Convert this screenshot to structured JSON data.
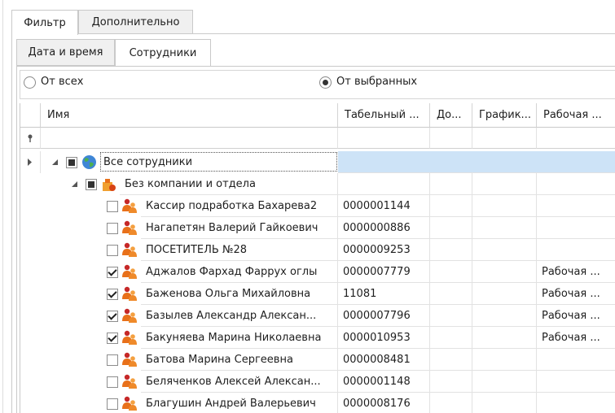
{
  "tabs": {
    "filter": "Фильтр",
    "additional": "Дополнительно"
  },
  "subtabs": {
    "datetime": "Дата и время",
    "employees": "Сотрудники"
  },
  "radios": {
    "from_all": "От всех",
    "from_selected": "От выбранных",
    "selected": "from_selected"
  },
  "grid": {
    "columns": [
      "Имя",
      "Табельный ...",
      "До...",
      "График...",
      "Рабочая ..."
    ],
    "root": "Все сотрудники",
    "group": "Без компании и отдела",
    "rows": [
      {
        "name": "Кассир подработка Бахарева2",
        "tab": "0000001144",
        "work": "",
        "checked": false
      },
      {
        "name": "Нагапетян Валерий Гайкоевич",
        "tab": "0000000886",
        "work": "",
        "checked": false
      },
      {
        "name": "ПОСЕТИТЕЛЬ №28",
        "tab": "0000009253",
        "work": "",
        "checked": false
      },
      {
        "name": "Аджалов Фархад Фаррух оглы",
        "tab": "0000007779",
        "work": "Рабочая ...",
        "checked": true
      },
      {
        "name": "Баженова Ольга Михайловна",
        "tab": "11081",
        "work": "Рабочая ...",
        "checked": true
      },
      {
        "name": "Базылев Александр Алексан...",
        "tab": "0000007796",
        "work": "Рабочая ...",
        "checked": true
      },
      {
        "name": "Бакуняева Марина Николаевна",
        "tab": "0000010953",
        "work": "Рабочая ...",
        "checked": true
      },
      {
        "name": "Батова Марина Сергеевна",
        "tab": "0000008481",
        "work": "",
        "checked": false
      },
      {
        "name": "Беляченков Алексей Алексан...",
        "tab": "0000001148",
        "work": "",
        "checked": false
      },
      {
        "name": "Благушин Андрей Валерьевич",
        "tab": "0000008176",
        "work": "",
        "checked": false
      }
    ]
  },
  "colors": {
    "selection": "#cde3f7",
    "border": "#c9c9c9",
    "user_icon": "#e8701a"
  }
}
